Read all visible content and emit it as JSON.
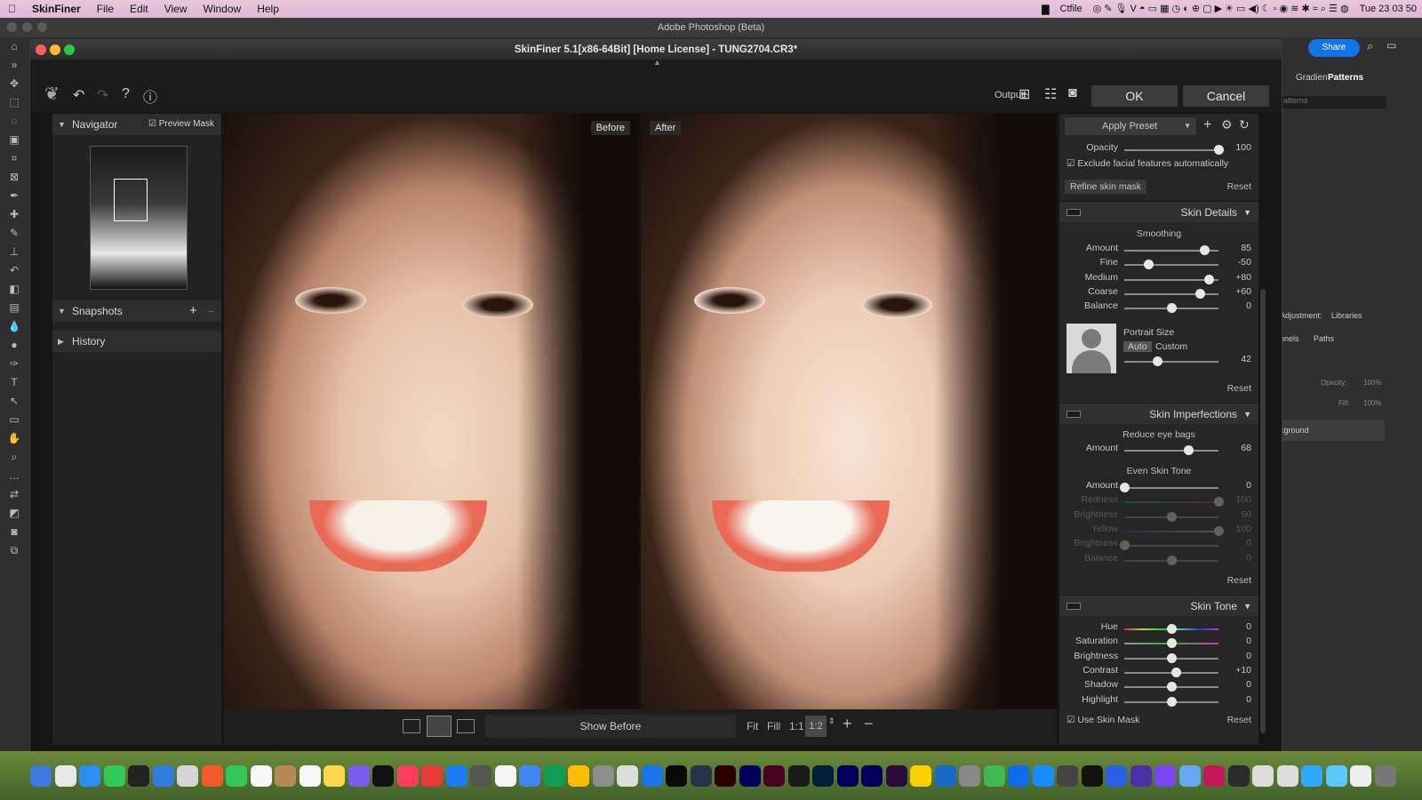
{
  "menubar": {
    "app": "SkinFiner",
    "items": [
      "File",
      "Edit",
      "View",
      "Window",
      "Help"
    ],
    "status_app": "Ctfile",
    "clock": "Tue 23 03 50"
  },
  "photoshop": {
    "title": "Adobe Photoshop (Beta)",
    "share": "Share",
    "panel_tabs": [
      "Gradien",
      "Patterns"
    ],
    "search_placeholder": "atterns",
    "panels2": [
      "Adjustment:",
      "Libraries"
    ],
    "panels3": [
      "nnels",
      "Paths"
    ],
    "opacity_label": "Opacity:",
    "opacity_val": "100%",
    "fill_label": "Fill:",
    "fill_val": "100%",
    "layer": "kground"
  },
  "window": {
    "title": "SkinFiner 5.1[x86-64Bit] [Home License] - TUNG2704.CR3*"
  },
  "toolbar": {
    "output_label": "Output:",
    "ok": "OK",
    "cancel": "Cancel"
  },
  "left": {
    "navigator": "Navigator",
    "preview_mask": "Preview Mask",
    "preview_checked": true,
    "snapshots": "Snapshots",
    "history": "History"
  },
  "view": {
    "before_tag": "Before",
    "after_tag": "After",
    "show_before": "Show Before",
    "fit": "Fit",
    "fill": "Fill",
    "one": "1:1",
    "zoom": "1:2"
  },
  "right": {
    "apply_preset": "Apply Preset",
    "opacity": {
      "label": "Opacity",
      "value": "100",
      "pos": 1.0
    },
    "exclude": "Exclude facial features automatically",
    "refine": "Refine skin mask",
    "reset": "Reset",
    "skin_details": "Skin Details",
    "smoothing": "Smoothing",
    "smooth_rows": [
      {
        "label": "Amount",
        "value": "85",
        "pos": 0.85
      },
      {
        "label": "Fine",
        "value": "-50",
        "pos": 0.25
      },
      {
        "label": "Medium",
        "value": "+80",
        "pos": 0.9
      },
      {
        "label": "Coarse",
        "value": "+60",
        "pos": 0.8
      },
      {
        "label": "Balance",
        "value": "0",
        "pos": 0.5
      }
    ],
    "portrait_size": "Portrait Size",
    "auto": "Auto",
    "custom": "Custom",
    "portrait": {
      "value": "42",
      "pos": 0.35
    },
    "skin_imperfections": "Skin Imperfections",
    "reduce_eye_bags": "Reduce eye bags",
    "eyebag": {
      "label": "Amount",
      "value": "68",
      "pos": 0.68
    },
    "even_tone": "Even Skin Tone",
    "even_rows": [
      {
        "label": "Amount",
        "value": "0",
        "pos": 0.0
      },
      {
        "label": "Redness",
        "value": "100",
        "pos": 1.0
      },
      {
        "label": "Brightness",
        "value": "50",
        "pos": 0.5
      },
      {
        "label": "Yellow",
        "value": "100",
        "pos": 1.0
      },
      {
        "label": "Brightness",
        "value": "0",
        "pos": 0.0
      },
      {
        "label": "Balance",
        "value": "0",
        "pos": 0.5
      }
    ],
    "skin_tone": "Skin Tone",
    "tone_rows": [
      {
        "label": "Hue",
        "value": "0",
        "pos": 0.5
      },
      {
        "label": "Saturation",
        "value": "0",
        "pos": 0.5
      },
      {
        "label": "Brightness",
        "value": "0",
        "pos": 0.5
      },
      {
        "label": "Contrast",
        "value": "+10",
        "pos": 0.55
      },
      {
        "label": "Shadow",
        "value": "0",
        "pos": 0.5
      },
      {
        "label": "Highlight",
        "value": "0",
        "pos": 0.5
      }
    ],
    "use_skin_mask": "Use Skin Mask"
  },
  "colors": {
    "accent": "#0a84ff",
    "ok_bg": "#3b3b3b",
    "panel": "#262626"
  }
}
